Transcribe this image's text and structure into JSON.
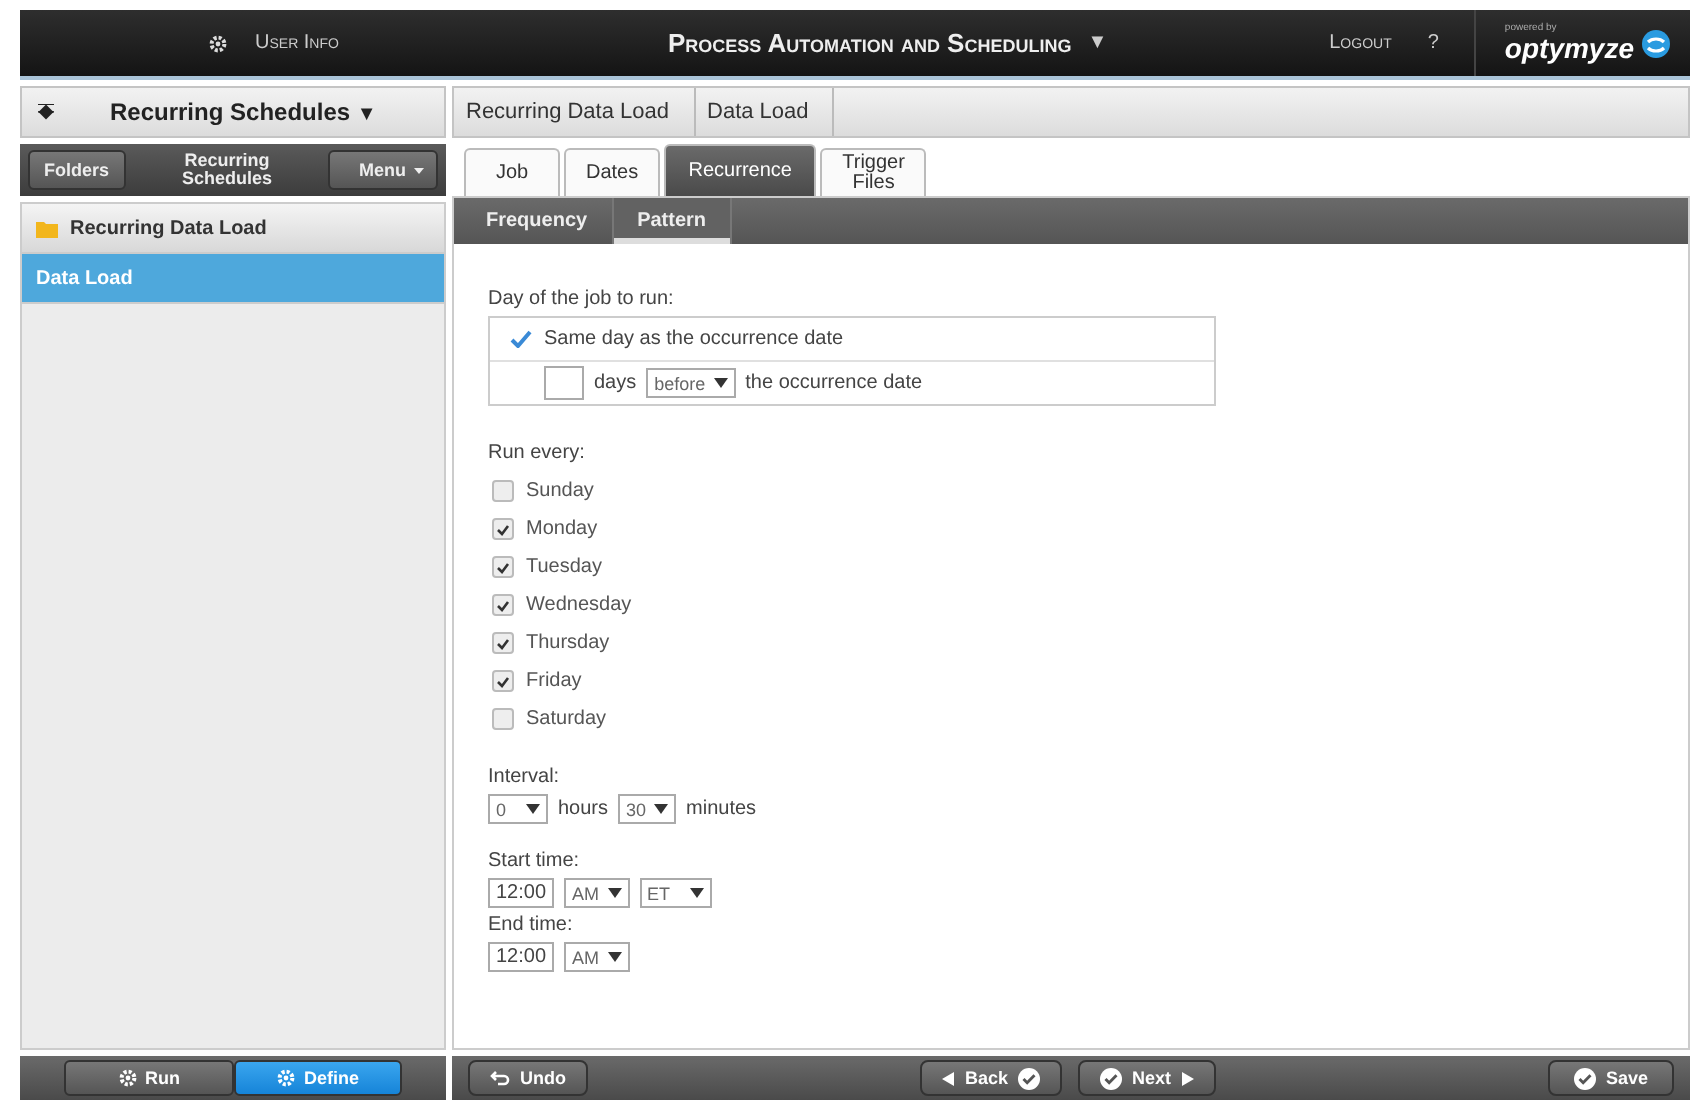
{
  "top_bar": {
    "user_info": "User Info",
    "title": "Process Automation and Scheduling",
    "title_caret": "▼",
    "logout": "Logout",
    "help": "?",
    "brand_tagline": "powered by",
    "brand": "optymyze"
  },
  "sidebar": {
    "title": "Recurring Schedules",
    "title_caret": "▼",
    "folders": "Folders",
    "toolbar_title": "Recurring Schedules",
    "menu": "Menu",
    "items": [
      {
        "label": "Recurring Data Load",
        "kind": "folder",
        "selected": false
      },
      {
        "label": "Data Load",
        "kind": "item",
        "selected": true
      }
    ],
    "modes": [
      {
        "label": "Run",
        "selected": false
      },
      {
        "label": "Define",
        "selected": true
      }
    ]
  },
  "breadcrumb": [
    "Recurring Data Load",
    "Data Load"
  ],
  "tabs": [
    {
      "label": "Job",
      "selected": false
    },
    {
      "label": "Dates",
      "selected": false
    },
    {
      "label": "Recurrence",
      "selected": true
    },
    {
      "label": "Trigger Files",
      "selected": false
    }
  ],
  "subtabs": [
    {
      "label": "Frequency",
      "selected": false
    },
    {
      "label": "Pattern",
      "selected": true
    }
  ],
  "day_of_job": {
    "label": "Day of the job to run:",
    "options": [
      {
        "kind": "same",
        "text": "Same day as the occurrence date",
        "selected": true
      },
      {
        "kind": "offset",
        "unit": "days",
        "relation": "before",
        "tail": "the occurrence date",
        "selected": false
      }
    ]
  },
  "run_every": {
    "label": "Run every:",
    "days": [
      {
        "label": "Sunday",
        "checked": false
      },
      {
        "label": "Monday",
        "checked": true
      },
      {
        "label": "Tuesday",
        "checked": true
      },
      {
        "label": "Wednesday",
        "checked": true
      },
      {
        "label": "Thursday",
        "checked": true
      },
      {
        "label": "Friday",
        "checked": true
      },
      {
        "label": "Saturday",
        "checked": false
      }
    ]
  },
  "interval": {
    "label": "Interval:",
    "hours": "0",
    "hours_unit": "hours",
    "minutes": "30",
    "minutes_unit": "minutes"
  },
  "start_time": {
    "label": "Start time:",
    "time": "12:00",
    "ampm": "AM",
    "zone": "ET"
  },
  "end_time": {
    "label": "End time:",
    "time": "12:00",
    "ampm": "AM"
  },
  "footer": {
    "undo": "Undo",
    "back": "Back",
    "next": "Next",
    "save": "Save"
  }
}
